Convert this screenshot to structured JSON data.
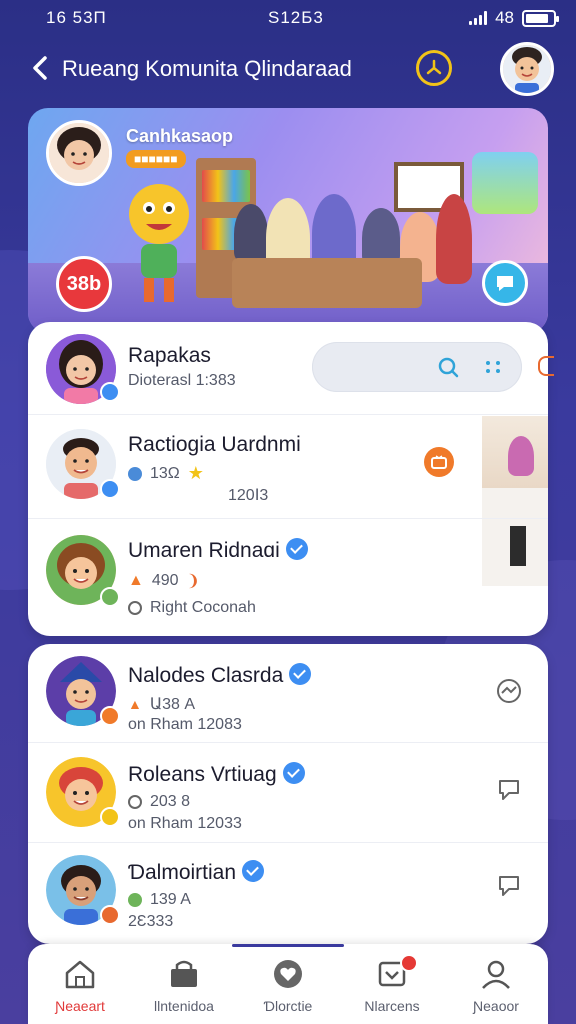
{
  "status_bar": {
    "time_left": "16 53П",
    "time_mid": "S12Б3",
    "battery": "48"
  },
  "header": {
    "title": "Rueang Komunita  Qlindaraad"
  },
  "banner": {
    "title": "Canhkasaop",
    "badge": "38b"
  },
  "section1": [
    {
      "name": "Rapakas",
      "meta1": "Dioterasl  1:383"
    },
    {
      "name": "Ractiogia Uardnmi",
      "meta1": "13Ω",
      "meta2": "120Ⅰ3"
    },
    {
      "name": "Umaren Ridnaɑi",
      "meta1": "490",
      "meta2": "Right   Coconah",
      "verified": true
    }
  ],
  "section2": [
    {
      "name": "Nalodes Clasrda",
      "meta1": "Ա38  A",
      "meta2": "on Rham   12083",
      "verified": true
    },
    {
      "name": "Roleans Vrtiuag",
      "meta1": "203  8",
      "meta2": "on Rham   12033",
      "verified": true
    },
    {
      "name": "Ɗalmoirtian",
      "meta1": "139  A",
      "meta2": "2Ɛ333",
      "verified": true
    }
  ],
  "nav": [
    {
      "label": "Ɲeaeart",
      "icon": "home-icon",
      "active": true
    },
    {
      "label": "Ɩlntenidoa",
      "icon": "shop-icon"
    },
    {
      "label": "Ɗlorctie",
      "icon": "heart-badge-icon"
    },
    {
      "label": "Nlarcens",
      "icon": "notification-icon",
      "badge": ""
    },
    {
      "label": "Ɲeaoor",
      "icon": "profile-icon"
    }
  ],
  "colors": {
    "bg": "#2b2f86",
    "accent": "#3d8ef2",
    "active_nav": "#e13a3a",
    "clock": "#f2c318"
  }
}
